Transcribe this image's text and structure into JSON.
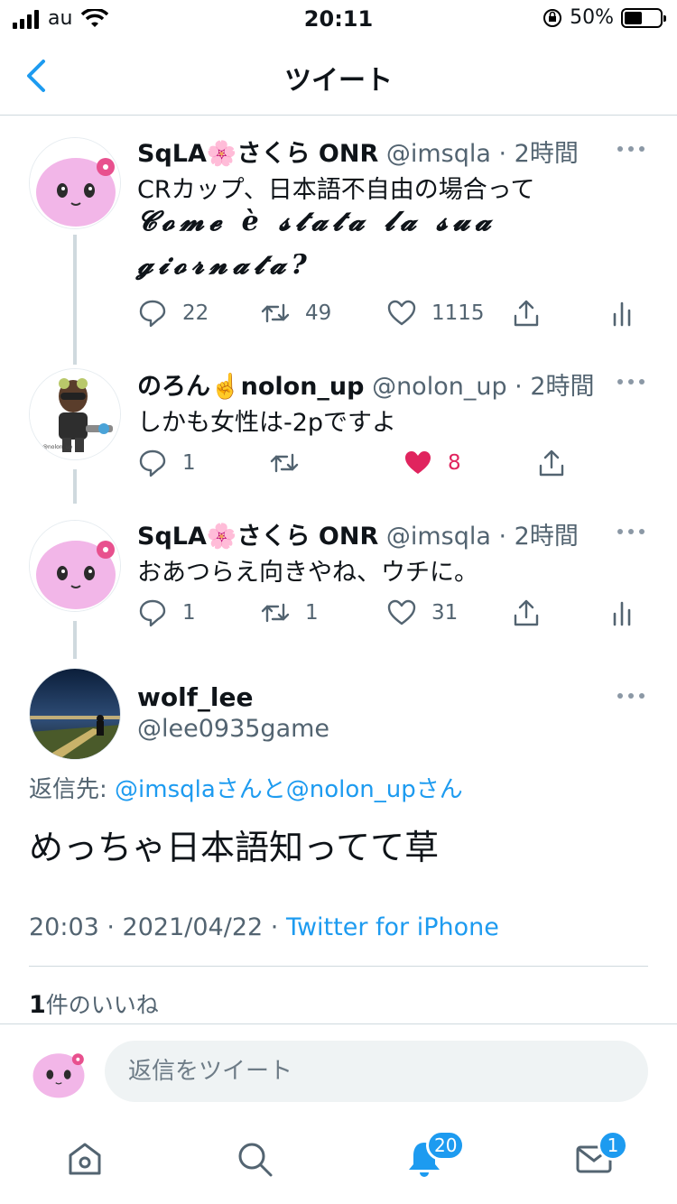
{
  "status_bar": {
    "carrier": "au",
    "time": "20:11",
    "battery": "50%",
    "battery_level": 0.5
  },
  "header": {
    "title": "ツイート"
  },
  "thread": [
    {
      "name": "SqLA🌸さくら ONR",
      "handle": "@imsqla",
      "time": "· 2時間",
      "text_lines": [
        "CRカップ、日本語不自由の場合って",
        "𝓒𝓸𝓶𝓮 è 𝓼𝓽𝓪𝓽𝓪 𝓵𝓪 𝓼𝓾𝓪",
        "𝓰𝓲𝓸𝓻𝓷𝓪𝓽𝓪?"
      ],
      "replies": "22",
      "retweets": "49",
      "likes": "1115",
      "liked": false,
      "show_analytics": true
    },
    {
      "name": "のろん☝️nolon_up",
      "handle": "@nolon_up",
      "time": "· 2時間",
      "text_lines": [
        "しかも女性は-2pですよ"
      ],
      "replies": "1",
      "retweets": "",
      "likes": "8",
      "liked": true,
      "show_analytics": false
    },
    {
      "name": "SqLA🌸さくら ONR",
      "handle": "@imsqla",
      "time": "· 2時間",
      "text_lines": [
        "おあつらえ向きやね、ウチに。"
      ],
      "replies": "1",
      "retweets": "1",
      "likes": "31",
      "liked": false,
      "show_analytics": true
    }
  ],
  "main_tweet": {
    "name": "wolf_lee",
    "handle": "@lee0935game",
    "reply_to_prefix": "返信先: ",
    "reply_to": "@imsqlaさんと@nolon_upさん",
    "text": "めっちゃ日本語知ってて草",
    "timestamp": "20:03 · 2021/04/22 · ",
    "client": "Twitter for iPhone",
    "likes_count": "1",
    "likes_label": "件のいいね"
  },
  "reply_box": {
    "placeholder": "返信をツイート"
  },
  "tabbar": {
    "notifications_badge": "20",
    "messages_badge": "1"
  },
  "colors": {
    "accent": "#1d9bf0",
    "like": "#e0245e",
    "text": "#0f1419",
    "muted": "#536471"
  },
  "icons": [
    "back-chevron-icon",
    "more-icon",
    "reply-icon",
    "retweet-icon",
    "heart-icon",
    "share-icon",
    "analytics-icon",
    "home-icon",
    "search-icon",
    "bell-icon",
    "mail-icon"
  ]
}
